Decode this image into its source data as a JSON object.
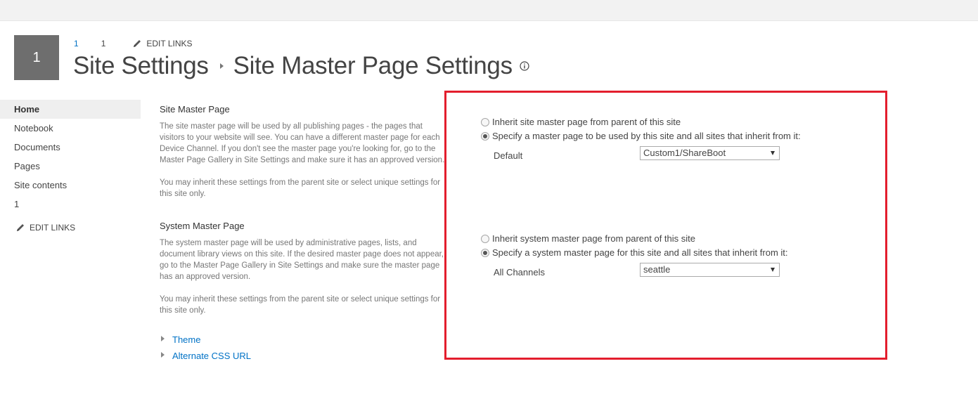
{
  "site_logo": {
    "text": "1"
  },
  "top_nav": {
    "items": [
      "1",
      "1"
    ],
    "edit_links_label": "EDIT LINKS"
  },
  "title": {
    "site": "Site Settings",
    "page": "Site Master Page Settings"
  },
  "left_nav": {
    "items": [
      "Home",
      "Notebook",
      "Documents",
      "Pages",
      "Site contents",
      "1"
    ],
    "selected": "Home",
    "edit_links_label": "EDIT LINKS"
  },
  "site_master": {
    "title": "Site Master Page",
    "desc_lines": [
      "The site master page will be used by all publishing pages - the pages that",
      "visitors to your website will see. You can have a different master page for each",
      "Device Channel. If you don't see the master page you're looking for, go to the",
      "Master Page Gallery in Site Settings and make sure it has an approved version."
    ],
    "desc2_lines": [
      "You may inherit these settings from the parent site or select unique settings for",
      "this site only."
    ],
    "options": [
      {
        "label": "Inherit site master page from parent of this site",
        "checked": false
      },
      {
        "label": "Specify a master page to be used by this site and all sites that inherit from it:",
        "checked": true
      }
    ],
    "field_label": "Default",
    "selected_value": "Custom1/ShareBoot"
  },
  "system_master": {
    "title": "System Master Page",
    "desc_lines": [
      "The system master page will be used by administrative pages, lists, and",
      "document library views on this site. If the desired master page does not appear,",
      "go to the Master Page Gallery in Site Settings and make sure the master page",
      "has an approved version."
    ],
    "desc2_lines": [
      "You may inherit these settings from the parent site or select unique settings for",
      "this site only."
    ],
    "options": [
      {
        "label": "Inherit system master page from parent of this site",
        "checked": false
      },
      {
        "label": "Specify a system master page for this site and all sites that inherit from it:",
        "checked": true
      }
    ],
    "field_label": "All Channels",
    "selected_value": "seattle"
  },
  "expanders": [
    "Theme",
    "Alternate CSS URL"
  ],
  "colors": {
    "accent_link": "#0072c6",
    "highlight_border": "#e31e2d",
    "logo_bg": "#6e6e6e"
  },
  "icons": {
    "edit": "pencil-icon",
    "info": "info-icon",
    "expand": "triangle-right-icon",
    "dropdown": "chevron-down-icon"
  }
}
